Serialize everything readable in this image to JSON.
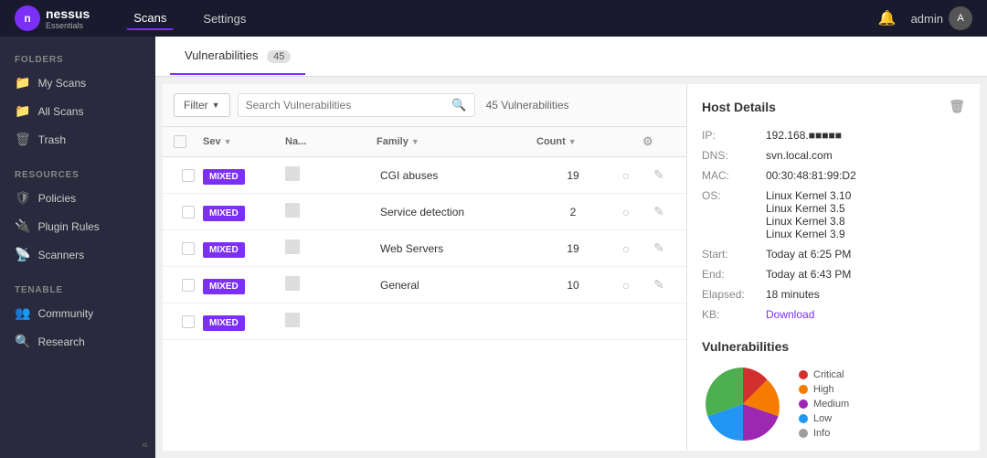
{
  "app": {
    "name": "nessus",
    "subname": "Essentials",
    "logo_letter": "n"
  },
  "topnav": {
    "items": [
      {
        "label": "Scans",
        "active": true
      },
      {
        "label": "Settings",
        "active": false
      }
    ],
    "bell_label": "🔔",
    "admin_label": "admin"
  },
  "sidebar": {
    "folders_label": "FOLDERS",
    "resources_label": "RESOURCES",
    "tenable_label": "TENABLE",
    "folders": [
      {
        "label": "My Scans",
        "icon": "📁",
        "active": false
      },
      {
        "label": "All Scans",
        "icon": "📁",
        "active": false
      },
      {
        "label": "Trash",
        "icon": "🗑",
        "active": false
      }
    ],
    "resources": [
      {
        "label": "Policies",
        "icon": "🛡",
        "active": false
      },
      {
        "label": "Plugin Rules",
        "icon": "🔌",
        "active": false
      },
      {
        "label": "Scanners",
        "icon": "📡",
        "active": false
      }
    ],
    "tenable": [
      {
        "label": "Community",
        "icon": "👥",
        "active": false
      },
      {
        "label": "Research",
        "icon": "🔍",
        "active": false
      }
    ]
  },
  "tabs": [
    {
      "label": "Vulnerabilities",
      "badge": "45",
      "active": true
    }
  ],
  "filter_bar": {
    "filter_label": "Filter",
    "search_placeholder": "Search Vulnerabilities",
    "results_text": "45 Vulnerabilities"
  },
  "table": {
    "columns": [
      {
        "label": "",
        "sortable": false
      },
      {
        "label": "Sev",
        "sortable": true
      },
      {
        "label": "Na...",
        "sortable": false
      },
      {
        "label": "Family",
        "sortable": true
      },
      {
        "label": "Count",
        "sortable": true
      },
      {
        "label": "",
        "sortable": false
      },
      {
        "label": "",
        "sortable": false
      }
    ],
    "rows": [
      {
        "sev": "MIXED",
        "name": "",
        "family": "CGI abuses",
        "count": "19"
      },
      {
        "sev": "MIXED",
        "name": "",
        "family": "Service detection",
        "count": "2"
      },
      {
        "sev": "MIXED",
        "name": "",
        "family": "Web Servers",
        "count": "19"
      },
      {
        "sev": "MIXED",
        "name": "",
        "family": "General",
        "count": "10"
      },
      {
        "sev": "MIXED",
        "name": "",
        "family": "",
        "count": ""
      }
    ]
  },
  "host_details": {
    "title": "Host Details",
    "fields": [
      {
        "label": "IP:",
        "value": "192.168.■■■■■"
      },
      {
        "label": "DNS:",
        "value": "svn.local.com"
      },
      {
        "label": "MAC:",
        "value": "00:30:48:81:99:D2"
      },
      {
        "label": "OS:",
        "value": "Linux Kernel 3.10\nLinux Kernel 3.5\nLinux Kernel 3.8\nLinux Kernel 3.9"
      },
      {
        "label": "Start:",
        "value": "Today at 6:25 PM"
      },
      {
        "label": "End:",
        "value": "Today at 6:43 PM"
      },
      {
        "label": "Elapsed:",
        "value": "18 minutes"
      },
      {
        "label": "KB:",
        "value": "Download",
        "is_link": true
      }
    ]
  },
  "vuln_chart": {
    "title": "Vulnerabilities",
    "legend": [
      {
        "label": "Critical",
        "color": "#d32f2f"
      },
      {
        "label": "High",
        "color": "#f57c00"
      },
      {
        "label": "Medium",
        "color": "#9c27b0"
      },
      {
        "label": "Low",
        "color": "#2196f3"
      },
      {
        "label": "Info",
        "color": "#9e9e9e"
      }
    ],
    "pie_data": [
      {
        "label": "Critical",
        "color": "#d32f2f",
        "percent": 15
      },
      {
        "label": "High",
        "color": "#f57c00",
        "percent": 20
      },
      {
        "label": "Medium",
        "color": "#9c27b0",
        "percent": 25
      },
      {
        "label": "Low",
        "color": "#2196f3",
        "percent": 20
      },
      {
        "label": "Info",
        "color": "#4caf50",
        "percent": 20
      }
    ]
  }
}
